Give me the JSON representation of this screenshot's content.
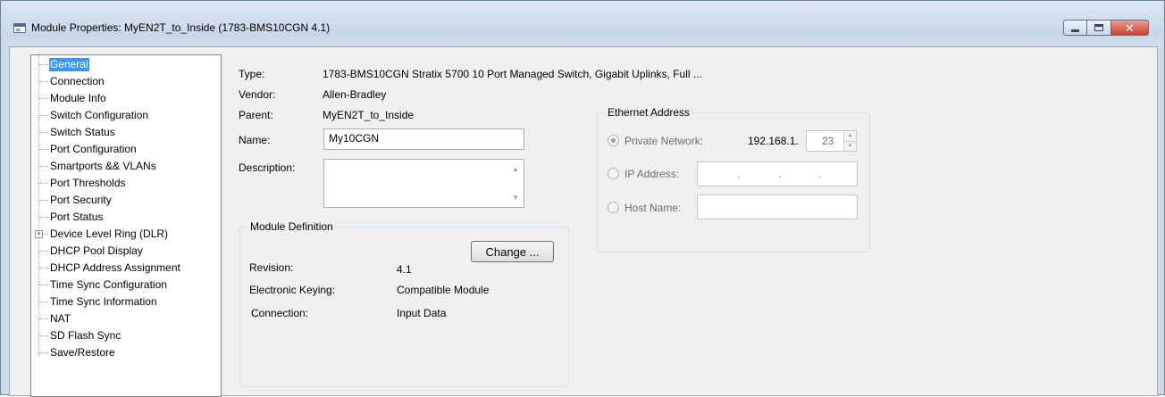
{
  "window": {
    "title": "Module Properties: MyEN2T_to_Inside (1783-BMS10CGN 4.1)",
    "controls": {
      "minimize": "minimize",
      "maximize": "maximize",
      "close": "close"
    }
  },
  "tree": {
    "items": [
      {
        "label": "General",
        "selected": true
      },
      {
        "label": "Connection"
      },
      {
        "label": "Module Info"
      },
      {
        "label": "Switch Configuration"
      },
      {
        "label": "Switch Status"
      },
      {
        "label": "Port Configuration"
      },
      {
        "label": "Smartports && VLANs"
      },
      {
        "label": "Port Thresholds"
      },
      {
        "label": "Port Security"
      },
      {
        "label": "Port Status"
      },
      {
        "label": "Device Level Ring (DLR)",
        "expandable": true
      },
      {
        "label": "DHCP Pool Display"
      },
      {
        "label": "DHCP Address Assignment"
      },
      {
        "label": "Time Sync Configuration"
      },
      {
        "label": "Time Sync Information"
      },
      {
        "label": "NAT"
      },
      {
        "label": "SD Flash Sync"
      },
      {
        "label": "Save/Restore"
      }
    ]
  },
  "general": {
    "type_label": "Type:",
    "type_value": "1783-BMS10CGN Stratix 5700 10 Port Managed Switch, Gigabit Uplinks, Full ...",
    "vendor_label": "Vendor:",
    "vendor_value": "Allen-Bradley",
    "parent_label": "Parent:",
    "parent_value": "MyEN2T_to_Inside",
    "name_label": "Name:",
    "name_value": "My10CGN",
    "description_label": "Description:",
    "description_value": ""
  },
  "module_definition": {
    "title": "Module Definition",
    "change_button": "Change ...",
    "revision_label": "Revision:",
    "revision_value": "4.1",
    "keying_label": "Electronic Keying:",
    "keying_value": "Compatible Module",
    "connection_label": "Connection:",
    "connection_value": "Input Data"
  },
  "ethernet_address": {
    "title": "Ethernet Address",
    "private_network_label": "Private Network:",
    "private_network_prefix": "192.168.1.",
    "private_network_octet": "23",
    "ip_address_label": "IP Address:",
    "host_name_label": "Host Name:",
    "selected": "private_network"
  }
}
